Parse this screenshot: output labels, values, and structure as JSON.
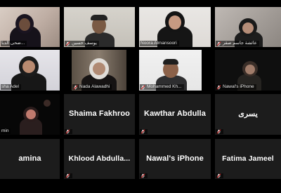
{
  "meeting": {
    "app": "Zoom",
    "view": "Gallery View",
    "colors": {
      "background": "#000000",
      "tile": "#1c1c1c",
      "muted_icon": "#e02b2b",
      "name_text": "#ffffff"
    }
  },
  "participants": [
    {
      "name": "ضحى الدبا...",
      "video": true,
      "muted": false
    },
    {
      "name": "يوسف حسين",
      "video": true,
      "muted": true
    },
    {
      "name": "Noora Almansoori",
      "video": true,
      "muted": false
    },
    {
      "name": "عائشة جاسم صقر",
      "video": true,
      "muted": true
    },
    {
      "name": "sha Adel",
      "video": true,
      "muted": false
    },
    {
      "name": "Nada Alawadhi",
      "video": true,
      "muted": true
    },
    {
      "name": "Mohammed Kh...",
      "video": true,
      "muted": true
    },
    {
      "name": "Nawal's iPhone",
      "video": true,
      "muted": true
    },
    {
      "name": "min",
      "video": true,
      "muted": false
    },
    {
      "name": "Shaima Fakhroo",
      "video": false,
      "muted": true
    },
    {
      "name": "Kawthar Abdulla",
      "video": false,
      "muted": true
    },
    {
      "name": "يسرى",
      "video": false,
      "muted": true
    },
    {
      "name": "amina",
      "video": false,
      "muted": false
    },
    {
      "name": "Khlood  Abdulla...",
      "video": false,
      "muted": true
    },
    {
      "name": "Nawal's iPhone",
      "video": false,
      "muted": true
    },
    {
      "name": "Fatima Jameel",
      "video": false,
      "muted": true
    }
  ]
}
